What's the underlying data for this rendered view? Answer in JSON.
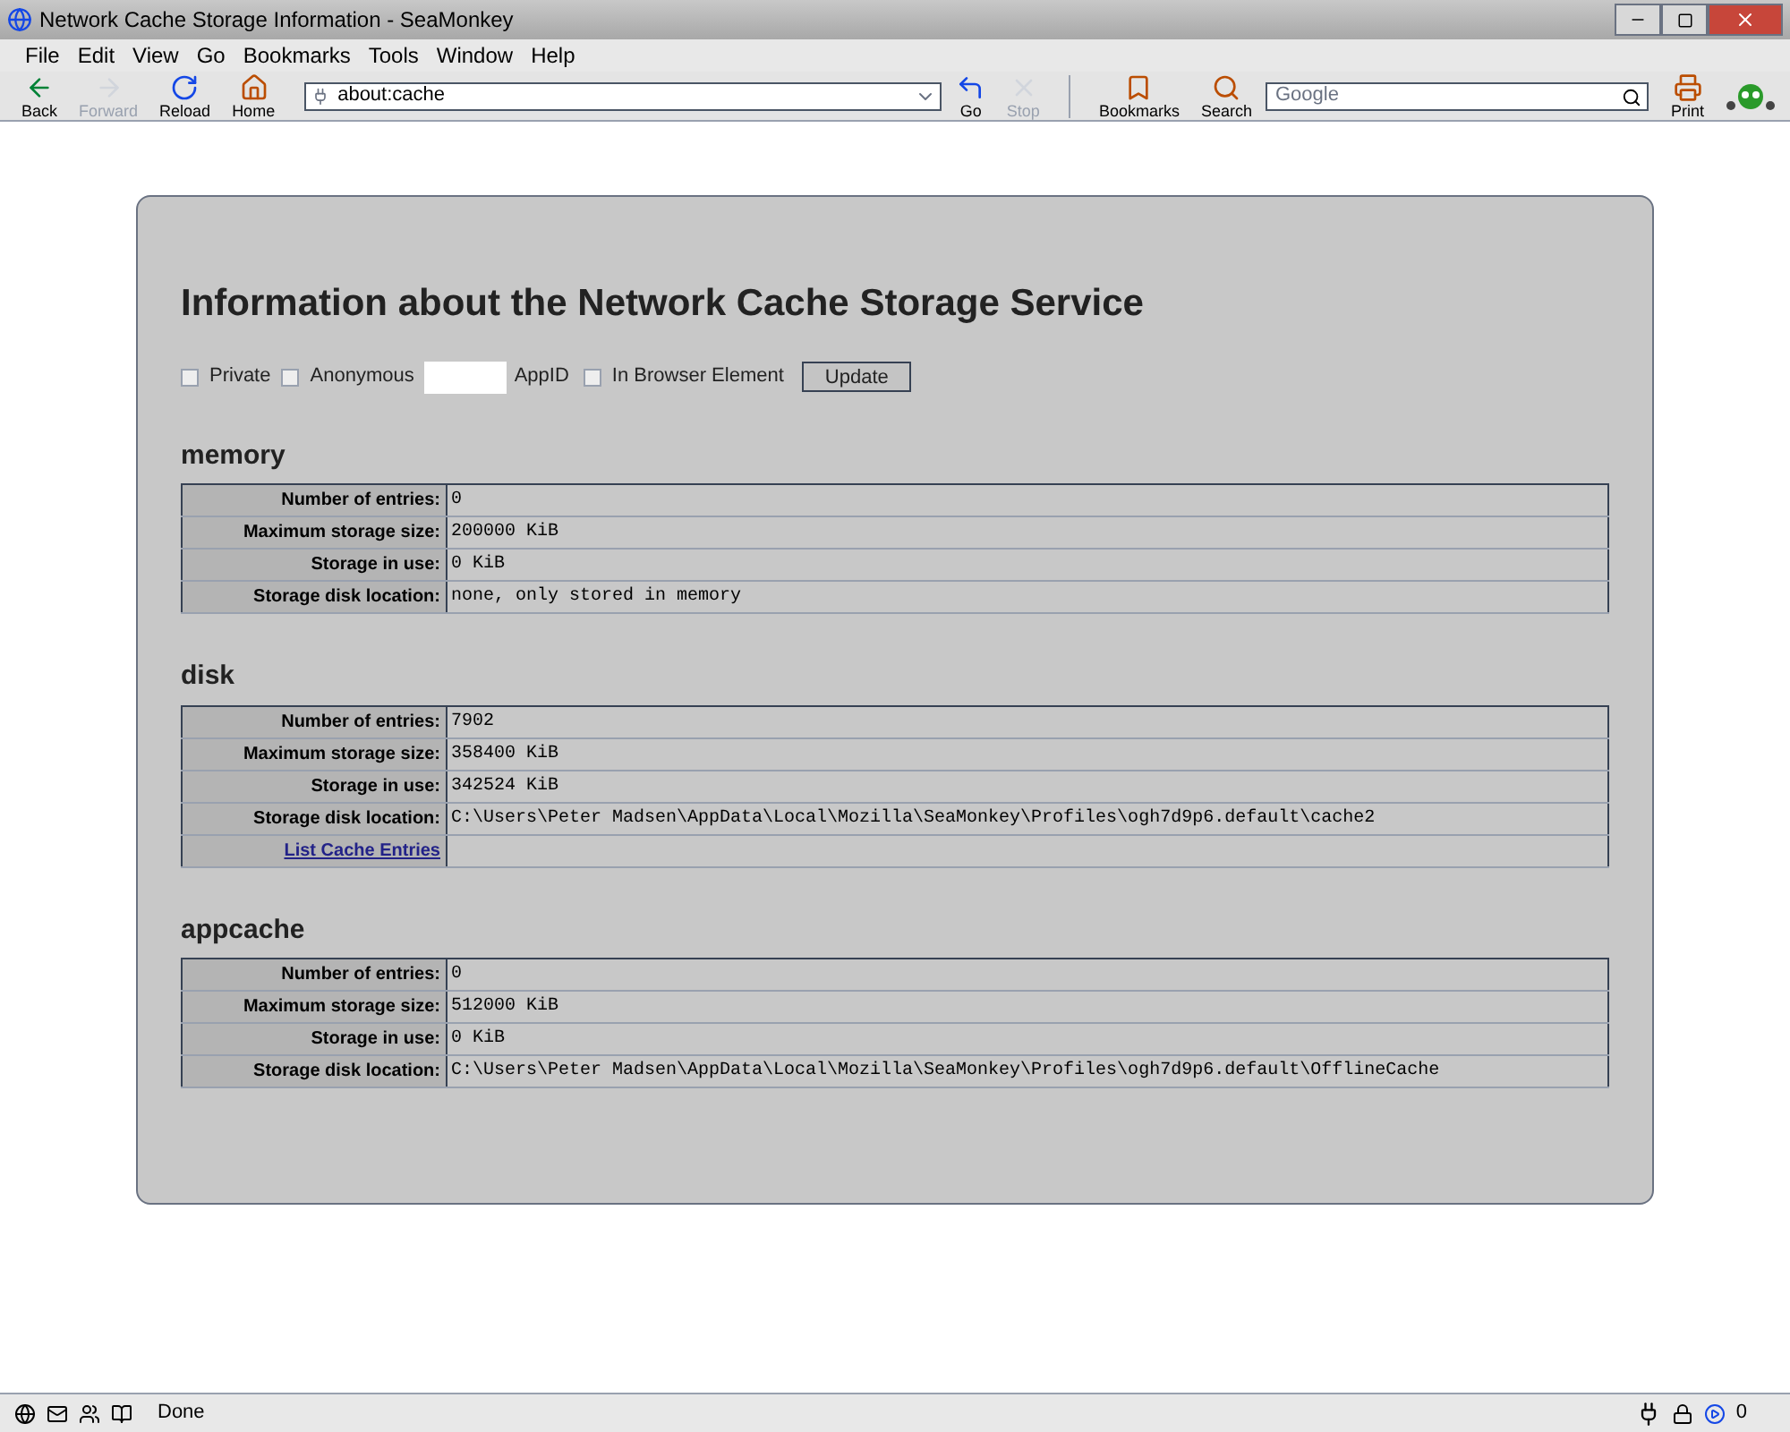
{
  "window": {
    "title": "Network Cache Storage Information - SeaMonkey"
  },
  "menu": [
    "File",
    "Edit",
    "View",
    "Go",
    "Bookmarks",
    "Tools",
    "Window",
    "Help"
  ],
  "toolbar": [
    {
      "kind": "back",
      "label": "Back",
      "disabled": false
    },
    {
      "kind": "forward",
      "label": "Forward",
      "disabled": true
    },
    {
      "kind": "reload",
      "label": "Reload",
      "disabled": false
    },
    {
      "kind": "home",
      "label": "Home",
      "disabled": false
    }
  ],
  "address": {
    "value": "about:cache"
  },
  "nav_buttons": [
    {
      "kind": "go",
      "label": "Go",
      "disabled": false
    },
    {
      "kind": "stop",
      "label": "Stop",
      "disabled": true
    },
    {
      "kind": "bookmarks",
      "label": "Bookmarks",
      "disabled": false
    },
    {
      "kind": "search",
      "label": "Search",
      "disabled": false
    }
  ],
  "search": {
    "placeholder": "Google"
  },
  "print": {
    "label": "Print"
  },
  "page": {
    "heading": "Information about the Network Cache Storage Service",
    "options": [
      {
        "kind": "checkbox",
        "label": "Private",
        "checked": false
      },
      {
        "kind": "checkbox",
        "label": "Anonymous",
        "checked": false
      },
      {
        "kind": "field",
        "label": "AppID"
      },
      {
        "kind": "checkbox",
        "label": "In Browser Element",
        "checked": false
      }
    ],
    "update_button": "Update",
    "sections": [
      {
        "name": "memory",
        "rows": [
          {
            "kind": "info",
            "label": "Number of entries:",
            "value": "0"
          },
          {
            "kind": "info",
            "label": "Maximum storage size:",
            "value": "200000 KiB"
          },
          {
            "kind": "info",
            "label": "Storage in use:",
            "value": "0 KiB"
          },
          {
            "kind": "info",
            "label": "Storage disk location:",
            "value": "none, only stored in memory"
          }
        ]
      },
      {
        "name": "disk",
        "rows": [
          {
            "kind": "info",
            "label": "Number of entries:",
            "value": "7902"
          },
          {
            "kind": "info",
            "label": "Maximum storage size:",
            "value": "358400 KiB"
          },
          {
            "kind": "info",
            "label": "Storage in use:",
            "value": "342524 KiB"
          },
          {
            "kind": "info",
            "label": "Storage disk location:",
            "value": "C:\\Users\\Peter Madsen\\AppData\\Local\\Mozilla\\SeaMonkey\\Profiles\\ogh7d9p6.default\\cache2"
          },
          {
            "kind": "link",
            "label": "List Cache Entries"
          }
        ]
      },
      {
        "name": "appcache",
        "rows": [
          {
            "kind": "info",
            "label": "Number of entries:",
            "value": "0"
          },
          {
            "kind": "info",
            "label": "Maximum storage size:",
            "value": "512000 KiB"
          },
          {
            "kind": "info",
            "label": "Storage in use:",
            "value": "0 KiB"
          },
          {
            "kind": "info",
            "label": "Storage disk location:",
            "value": "C:\\Users\\Peter Madsen\\AppData\\Local\\Mozilla\\SeaMonkey\\Profiles\\ogh7d9p6.default\\OfflineCache"
          }
        ]
      }
    ]
  },
  "status_bar": {
    "text": "Done",
    "count": "0"
  }
}
